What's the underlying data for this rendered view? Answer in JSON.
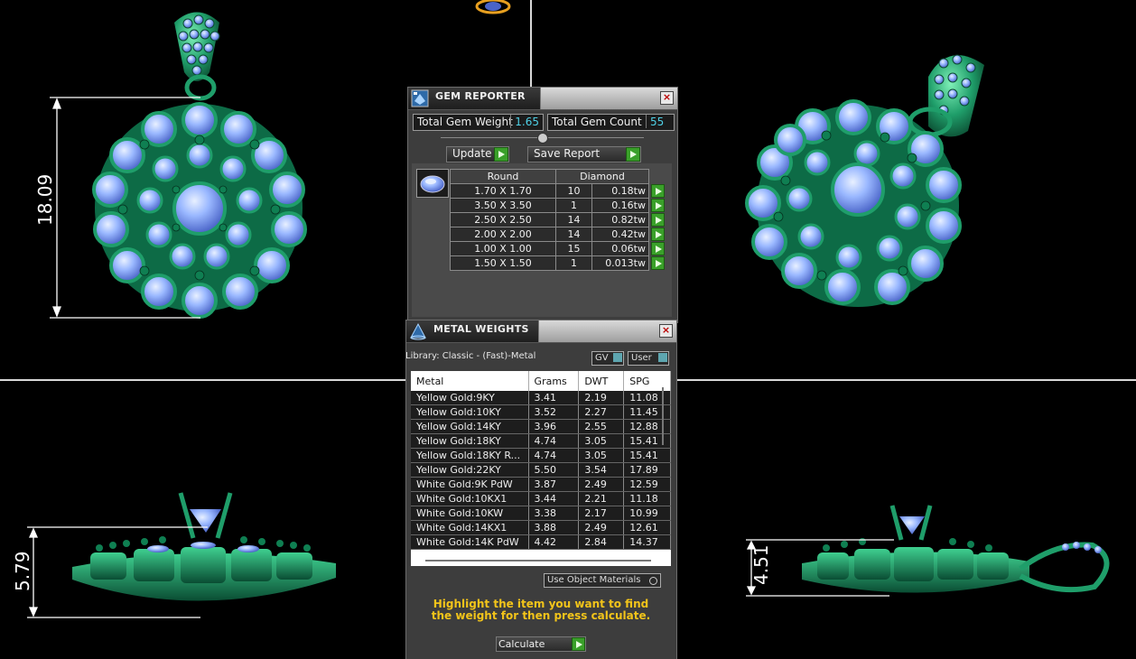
{
  "gem_reporter": {
    "title": "GEM REPORTER",
    "total_gem_weight_label": "Total Gem Weight",
    "total_gem_weight_value": "1.65",
    "total_gem_count_label": "Total Gem Count",
    "total_gem_count_value": "55",
    "update_label": "Update",
    "save_report_label": "Save Report",
    "col_shape": "Round",
    "col_type": "Diamond",
    "rows": [
      {
        "size": "1.70 X 1.70",
        "count": "10",
        "weight": "0.18tw"
      },
      {
        "size": "3.50 X 3.50",
        "count": "1",
        "weight": "0.16tw"
      },
      {
        "size": "2.50 X 2.50",
        "count": "14",
        "weight": "0.82tw"
      },
      {
        "size": "2.00 X 2.00",
        "count": "14",
        "weight": "0.42tw"
      },
      {
        "size": "1.00 X 1.00",
        "count": "15",
        "weight": "0.06tw"
      },
      {
        "size": "1.50 X 1.50",
        "count": "1",
        "weight": "0.013tw"
      }
    ]
  },
  "metal_weights": {
    "title": "METAL WEIGHTS",
    "library_label": "Library: Classic - (Fast)-Metal",
    "gv_label": "GV",
    "user_label": "User",
    "columns": [
      "Metal",
      "Grams",
      "DWT",
      "SPG"
    ],
    "rows": [
      [
        "Yellow Gold:9KY",
        "3.41",
        "2.19",
        "11.08"
      ],
      [
        "Yellow Gold:10KY",
        "3.52",
        "2.27",
        "11.45"
      ],
      [
        "Yellow Gold:14KY",
        "3.96",
        "2.55",
        "12.88"
      ],
      [
        "Yellow Gold:18KY",
        "4.74",
        "3.05",
        "15.41"
      ],
      [
        "Yellow Gold:18KY R...",
        "4.74",
        "3.05",
        "15.41"
      ],
      [
        "Yellow Gold:22KY",
        "5.50",
        "3.54",
        "17.89"
      ],
      [
        "White Gold:9K PdW",
        "3.87",
        "2.49",
        "12.59"
      ],
      [
        "White Gold:10KX1",
        "3.44",
        "2.21",
        "11.18"
      ],
      [
        "White Gold:10KW",
        "3.38",
        "2.17",
        "10.99"
      ],
      [
        "White Gold:14KX1",
        "3.88",
        "2.49",
        "12.61"
      ],
      [
        "White Gold:14K PdW",
        "4.42",
        "2.84",
        "14.37"
      ]
    ],
    "use_object_materials_label": "Use Object Materials",
    "note": "Highlight the item you want to find the weight for then press calculate.",
    "calculate_label": "Calculate"
  },
  "dimensions": {
    "front_height": "18.09",
    "side_height": "5.79",
    "right_height": "4.51"
  },
  "colors": {
    "metal": "#1f9e6a",
    "gem": "#9ab8ff",
    "note": "#f2c41a",
    "accent_value": "#4fd0e6"
  }
}
